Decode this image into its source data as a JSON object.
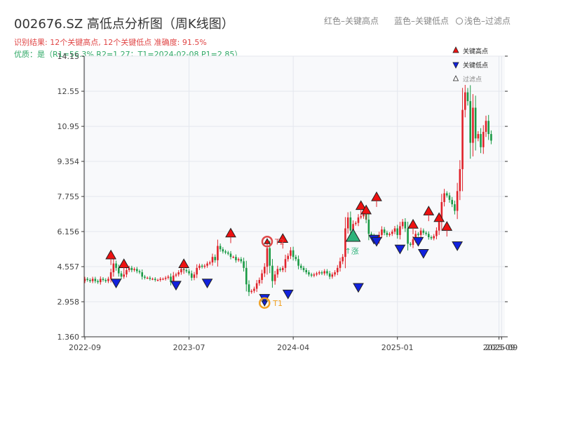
{
  "header": {
    "title": "002676.SZ 高低点分析图（周K线图）",
    "note_red": "红色–关键高点",
    "note_blue": "蓝色–关键低点",
    "note_filtered": "浅色–过滤点",
    "result_line": "识别结果: 12个关键高点, 12个关键低点   准确度: 91.5%",
    "quality_line": "优质：是（R1=56.3%  R2=1.27；T1=2024-02-08 P1=2.85）"
  },
  "colors": {
    "up": "#e0222a",
    "down": "#1a9a45",
    "key_high": "#ee1111",
    "key_low": "#1122dd",
    "t1": "#f0a020",
    "t2": "#e04848",
    "breakout": "#2db37a",
    "plot_bg": "#f8f9fb",
    "grid": "#e4e7ee"
  },
  "chart_data": {
    "type": "candlestick",
    "xlabel": "",
    "ylabel": "",
    "x_ticks": [
      "2022-09",
      "2023-07",
      "2024-04",
      "2025-01",
      "2025-09",
      "2025-09"
    ],
    "x_tick_indices": [
      0,
      40,
      80,
      120,
      159,
      160
    ],
    "y_ticks": [
      1.36,
      2.958,
      4.557,
      6.156,
      7.755,
      9.354,
      10.95,
      12.55,
      14.15
    ],
    "y_tick_labels": [
      "1.360",
      "2.958",
      "4.557",
      "6.156",
      "7.755",
      "9.354",
      "10.95",
      "12.55",
      "14.15"
    ],
    "ylim": [
      1.36,
      14.15
    ],
    "legend": {
      "position": "top-right",
      "items": [
        {
          "label": "关键高点",
          "marker": "key-high"
        },
        {
          "label": "关键低点",
          "marker": "key-low"
        },
        {
          "label": "过滤点",
          "marker": "filtered"
        }
      ]
    },
    "closes": [
      4.0,
      3.95,
      3.9,
      4.0,
      3.9,
      3.85,
      4.0,
      3.95,
      3.9,
      4.0,
      4.3,
      4.7,
      4.5,
      4.25,
      4.1,
      4.2,
      4.4,
      4.5,
      4.4,
      4.45,
      4.35,
      4.3,
      4.1,
      4.05,
      4.05,
      4.0,
      4.0,
      3.95,
      3.95,
      4.0,
      4.0,
      4.05,
      4.1,
      3.85,
      4.15,
      4.2,
      4.3,
      4.45,
      4.4,
      4.35,
      4.25,
      4.05,
      4.2,
      4.5,
      4.6,
      4.55,
      4.6,
      4.7,
      4.75,
      5.0,
      4.85,
      5.5,
      5.35,
      5.25,
      5.2,
      5.15,
      5.0,
      5.0,
      4.85,
      4.9,
      4.8,
      4.5,
      3.75,
      3.4,
      3.45,
      3.55,
      3.8,
      3.95,
      4.25,
      4.55,
      5.4,
      4.6,
      3.9,
      4.2,
      4.45,
      4.4,
      4.5,
      4.9,
      5.05,
      5.3,
      5.0,
      4.9,
      4.6,
      4.5,
      4.4,
      4.3,
      4.2,
      4.15,
      4.2,
      4.25,
      4.3,
      4.25,
      4.35,
      4.25,
      4.1,
      4.2,
      4.3,
      4.5,
      4.8,
      5.0,
      6.3,
      6.8,
      6.2,
      6.5,
      6.55,
      6.8,
      6.85,
      7.0,
      6.7,
      6.05,
      5.95,
      5.8,
      5.75,
      6.0,
      6.25,
      6.1,
      6.0,
      6.05,
      6.15,
      6.3,
      6.0,
      6.4,
      6.6,
      6.3,
      5.6,
      5.55,
      5.8,
      6.05,
      6.0,
      6.2,
      6.1,
      6.05,
      5.9,
      5.85,
      5.95,
      6.2,
      6.6,
      7.5,
      7.9,
      7.8,
      7.6,
      7.4,
      7.1,
      8.0,
      9.0,
      11.7,
      12.5,
      12.1,
      10.2,
      11.8,
      10.4,
      10.6,
      10.0,
      10.7,
      11.2,
      10.6,
      10.3
    ],
    "key_highs": [
      {
        "i": 10,
        "v": 4.95
      },
      {
        "i": 15,
        "v": 4.55
      },
      {
        "i": 38,
        "v": 4.55
      },
      {
        "i": 56,
        "v": 5.95
      },
      {
        "i": 76,
        "v": 5.7
      },
      {
        "i": 106,
        "v": 7.2
      },
      {
        "i": 108,
        "v": 7.0
      },
      {
        "i": 112,
        "v": 7.6
      },
      {
        "i": 126,
        "v": 6.35
      },
      {
        "i": 132,
        "v": 6.95
      },
      {
        "i": 136,
        "v": 6.65
      },
      {
        "i": 139,
        "v": 6.25
      }
    ],
    "key_lows": [
      {
        "i": 12,
        "v": 3.95
      },
      {
        "i": 35,
        "v": 3.85
      },
      {
        "i": 47,
        "v": 3.95
      },
      {
        "i": 69,
        "v": 3.25
      },
      {
        "i": 78,
        "v": 3.45
      },
      {
        "i": 105,
        "v": 3.75
      },
      {
        "i": 111,
        "v": 5.95
      },
      {
        "i": 112,
        "v": 5.85
      },
      {
        "i": 121,
        "v": 5.5
      },
      {
        "i": 128,
        "v": 5.85
      },
      {
        "i": 130,
        "v": 5.3
      },
      {
        "i": 143,
        "v": 5.65
      }
    ],
    "annotations": [
      {
        "id": "T1",
        "label": "T1",
        "i": 69,
        "v": 2.9
      },
      {
        "id": "T2",
        "label": "T2",
        "i": 70,
        "v": 5.7
      },
      {
        "id": "breakout",
        "label": "↑涨",
        "i": 103,
        "v": 5.95
      }
    ]
  }
}
